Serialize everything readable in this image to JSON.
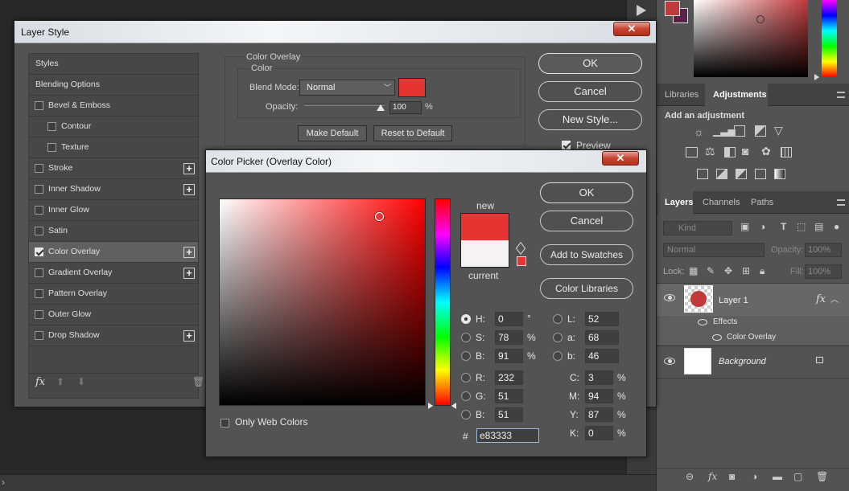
{
  "background_window": {
    "swatches": {
      "foreground": "#c0393b",
      "background": "#5b2248"
    },
    "panel_tabs_top": [
      "Libraries",
      "Adjustments"
    ],
    "add_adjustment": "Add an adjustment",
    "panel_tabs_layers": [
      "Layers",
      "Channels",
      "Paths"
    ],
    "kind_filter": "Kind",
    "blend_mode": "Normal",
    "opacity_label": "Opacity:",
    "opacity_value": "100%",
    "lock_label": "Lock:",
    "fill_label": "Fill:",
    "fill_value": "100%",
    "layers": [
      {
        "name": "Layer 1",
        "effects_label": "Effects",
        "effect": "Color Overlay"
      },
      {
        "name": "Background"
      }
    ]
  },
  "layer_style": {
    "title": "Layer Style",
    "styles_list": [
      {
        "label": "Styles",
        "type": "header"
      },
      {
        "label": "Blending Options",
        "type": "header"
      },
      {
        "label": "Bevel & Emboss",
        "checked": false,
        "plus": false
      },
      {
        "label": "Contour",
        "checked": false,
        "plus": false,
        "indent": true
      },
      {
        "label": "Texture",
        "checked": false,
        "plus": false,
        "indent": true
      },
      {
        "label": "Stroke",
        "checked": false,
        "plus": true
      },
      {
        "label": "Inner Shadow",
        "checked": false,
        "plus": true
      },
      {
        "label": "Inner Glow",
        "checked": false,
        "plus": false
      },
      {
        "label": "Satin",
        "checked": false,
        "plus": false
      },
      {
        "label": "Color Overlay",
        "checked": true,
        "plus": true,
        "selected": true
      },
      {
        "label": "Gradient Overlay",
        "checked": false,
        "plus": true
      },
      {
        "label": "Pattern Overlay",
        "checked": false,
        "plus": false
      },
      {
        "label": "Outer Glow",
        "checked": false,
        "plus": false
      },
      {
        "label": "Drop Shadow",
        "checked": false,
        "plus": true
      }
    ],
    "fx_label": "fx",
    "group_title": "Color Overlay",
    "subgroup_title": "Color",
    "blend_mode_label": "Blend Mode:",
    "blend_mode_value": "Normal",
    "overlay_color": "#e83333",
    "opacity_label": "Opacity:",
    "opacity_value": "100",
    "opacity_unit": "%",
    "opacity_level": 1.0,
    "make_default": "Make Default",
    "reset_default": "Reset to Default",
    "buttons": {
      "ok": "OK",
      "cancel": "Cancel",
      "new_style": "New Style..."
    },
    "preview_label": "Preview",
    "preview_checked": true
  },
  "color_picker": {
    "title": "Color Picker (Overlay Color)",
    "new_label": "new",
    "current_label": "current",
    "new_color": "#e83333",
    "current_color": "#f5f2f1",
    "buttons": {
      "ok": "OK",
      "cancel": "Cancel",
      "add_swatches": "Add to Swatches",
      "color_libraries": "Color Libraries"
    },
    "only_web_colors": "Only Web Colors",
    "hsb": [
      {
        "label": "H:",
        "value": "0",
        "unit": "°",
        "selected": true
      },
      {
        "label": "S:",
        "value": "78",
        "unit": "%"
      },
      {
        "label": "B:",
        "value": "91",
        "unit": "%"
      }
    ],
    "rgb": [
      {
        "label": "R:",
        "value": "232"
      },
      {
        "label": "G:",
        "value": "51"
      },
      {
        "label": "B:",
        "value": "51"
      }
    ],
    "lab": [
      {
        "label": "L:",
        "value": "52"
      },
      {
        "label": "a:",
        "value": "68"
      },
      {
        "label": "b:",
        "value": "46"
      }
    ],
    "cmyk": [
      {
        "label": "C:",
        "value": "3",
        "unit": "%"
      },
      {
        "label": "M:",
        "value": "94",
        "unit": "%"
      },
      {
        "label": "Y:",
        "value": "87",
        "unit": "%"
      },
      {
        "label": "K:",
        "value": "0",
        "unit": "%"
      }
    ],
    "hex_label": "#",
    "hex_value": "e83333",
    "hue_fraction": 0.0,
    "saturation": 0.78,
    "brightness": 0.91
  }
}
